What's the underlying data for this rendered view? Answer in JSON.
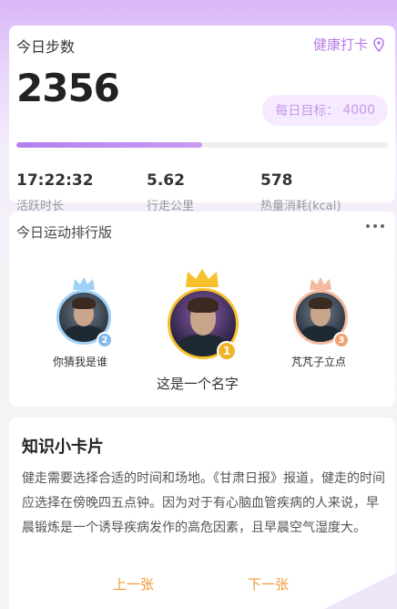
{
  "steps": {
    "title": "今日步数",
    "checkin_label": "健康打卡",
    "count": "2356",
    "goal_label": "每日目标：",
    "goal_value": "4000",
    "progress_fraction": 0.5,
    "stats": [
      {
        "value": "17:22:32",
        "label": "活跃时长"
      },
      {
        "value": "5.62",
        "label": "行走公里"
      },
      {
        "value": "578",
        "label": "热量消耗(kcal)"
      }
    ]
  },
  "ranking": {
    "title": "今日运动排行版",
    "players": [
      {
        "name": "你猜我是谁",
        "rank": "2",
        "crown_color": "#9fd0f5",
        "badge_color": "#7fb8ee"
      },
      {
        "name": "这是一个名字",
        "rank": "1",
        "crown_color": "#f6c12a",
        "badge_color": "#f0b429"
      },
      {
        "name": "芃芃子立点",
        "rank": "3",
        "crown_color": "#f5b9a0",
        "badge_color": "#f0a070"
      }
    ]
  },
  "knowledge": {
    "title": "知识小卡片",
    "text": "健走需要选择合适的时间和场地。《甘肃日报》报道，健走的时间应选择在傍晚四五点钟。因为对于有心脑血管疾病的人来说，早晨锻炼是一个诱导疾病发作的高危因素，且早晨空气湿度大。",
    "prev_label": "上一张",
    "next_label": "下一张"
  }
}
